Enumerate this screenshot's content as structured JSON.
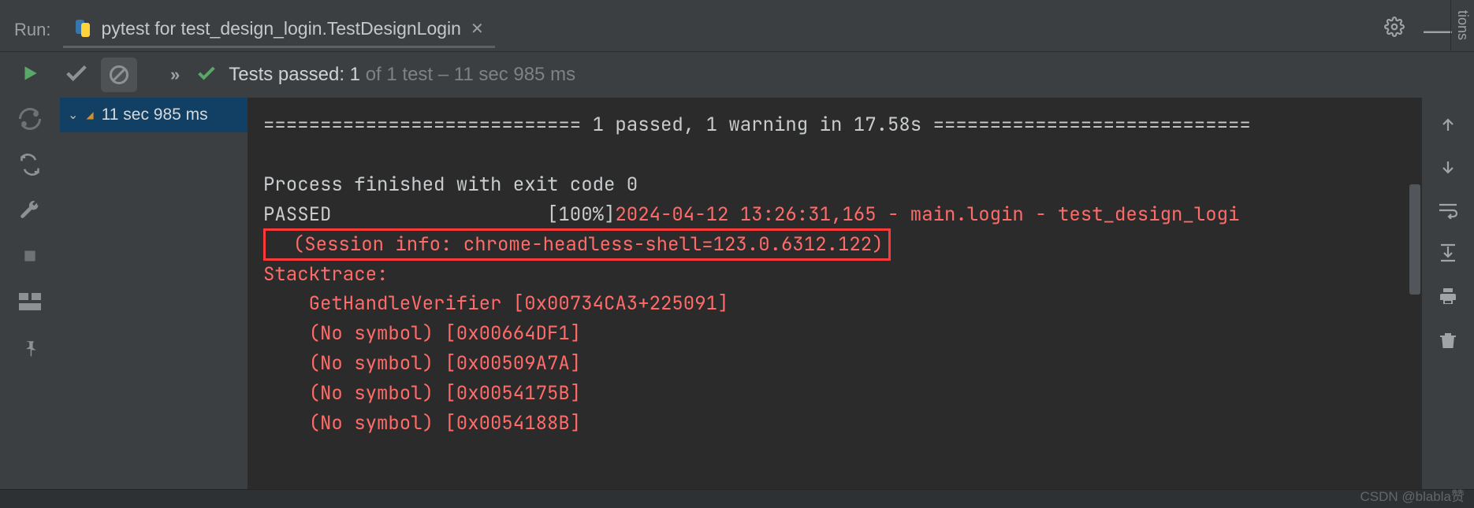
{
  "header": {
    "run_label": "Run:",
    "tab_title": "pytest for test_design_login.TestDesignLogin"
  },
  "status": {
    "prefix": "Tests passed: ",
    "count": "1",
    "suffix": " of 1 test – 11 sec 985 ms"
  },
  "tree": {
    "time": "11 sec 985 ms"
  },
  "console": {
    "sep_line": "============================ 1 passed, 1 warning in 17.58s ============================",
    "blank": "",
    "process_line": "Process finished with exit code 0",
    "passed_label": "PASSED",
    "passed_pct": "                   [100%]",
    "timestamp_line": "2024-04-12 13:26:31,165 - main.login - test_design_logi",
    "session_info": "  (Session info: chrome-headless-shell=123.0.6312.122)",
    "stacktrace_label": "Stacktrace:",
    "trace1": "    GetHandleVerifier [0x00734CA3+225091]",
    "trace2": "    (No symbol) [0x00664DF1]",
    "trace3": "    (No symbol) [0x00509A7A]",
    "trace4": "    (No symbol) [0x0054175B]",
    "trace5": "    (No symbol) [0x0054188B]"
  },
  "watermark": "CSDN @blabla赞",
  "vtab_label": "tions"
}
